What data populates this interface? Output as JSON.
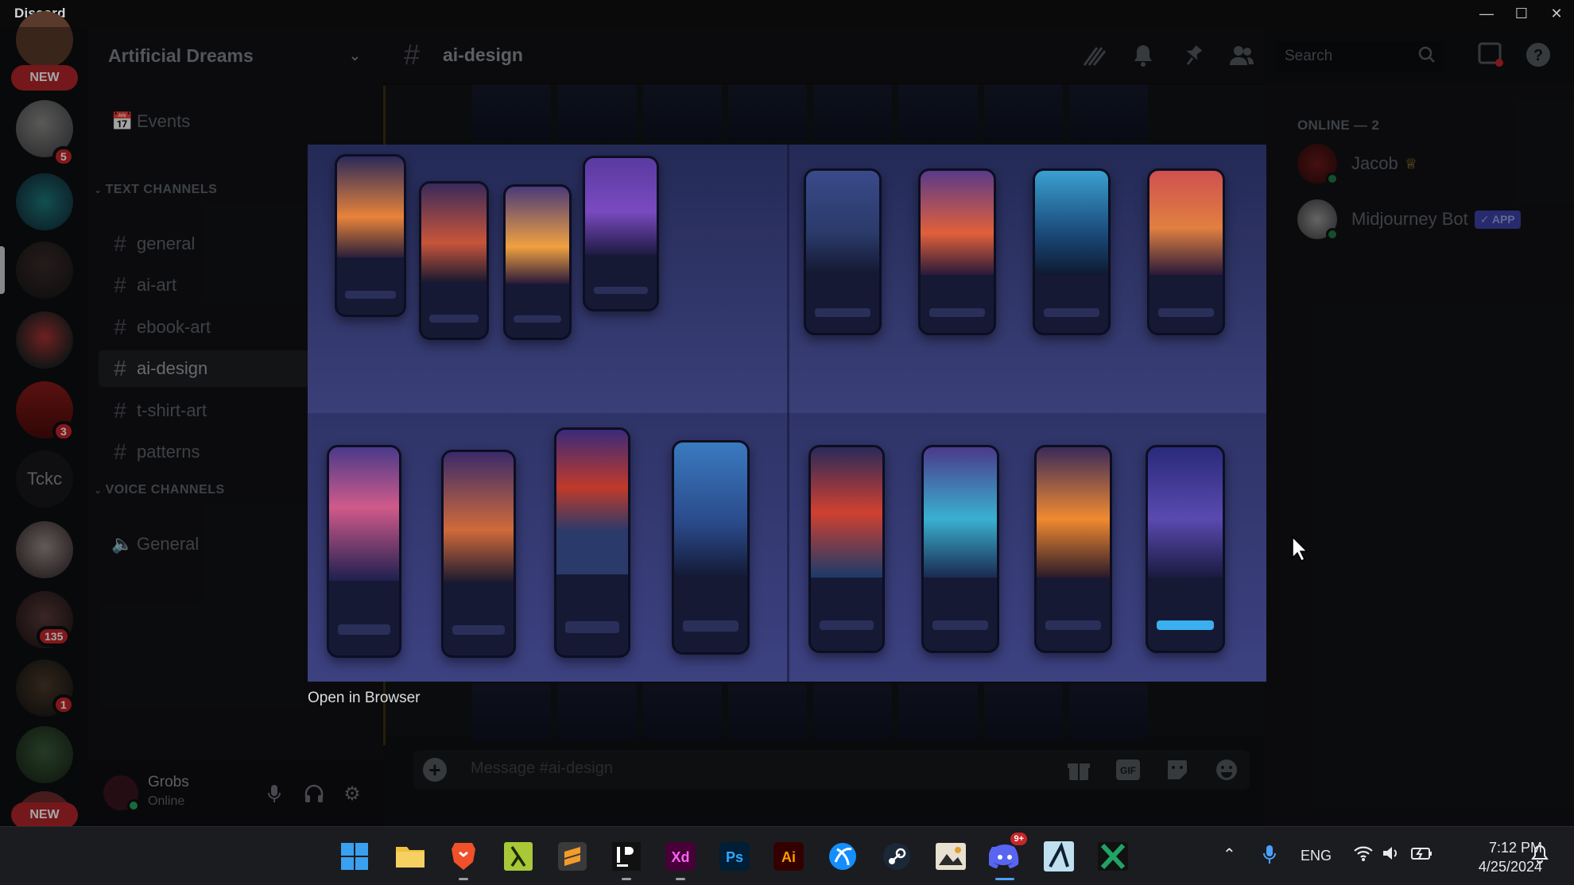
{
  "app": {
    "title": "Discord",
    "window_controls": [
      "minimize",
      "maximize",
      "close"
    ]
  },
  "servers": {
    "new_top": "NEW",
    "new_bottom": "NEW",
    "badges": [
      "5",
      "3",
      "135",
      "1"
    ],
    "tckc": "Tckc"
  },
  "sidebar": {
    "server_name": "Artificial Dreams",
    "events": "Events",
    "text_header": "TEXT CHANNELS",
    "text_channels": [
      "general",
      "ai-art",
      "ebook-art",
      "ai-design",
      "t-shirt-art",
      "patterns"
    ],
    "voice_header": "VOICE CHANNELS",
    "voice_channels": [
      "General"
    ],
    "active": "ai-design"
  },
  "user": {
    "name": "Grobs",
    "status": "Online"
  },
  "header": {
    "channel": "ai-design",
    "search_placeholder": "Search"
  },
  "composer": {
    "placeholder": "Message #ai-design"
  },
  "members": {
    "online_header": "ONLINE — 2",
    "list": [
      {
        "name": "Jacob",
        "crown": true
      },
      {
        "name": "Midjourney Bot",
        "badge": "✓ APP"
      }
    ]
  },
  "preview": {
    "open_link": "Open in Browser"
  },
  "taskbar": {
    "apps": [
      "windows-start",
      "file-explorer",
      "brave",
      "lambda-app",
      "sublime-text",
      "jetbrains",
      "adobe-xd",
      "photoshop",
      "illustrator",
      "battlenet",
      "steam",
      "picture-app",
      "discord",
      "unknown-app",
      "excel"
    ],
    "discord_badge": "9+",
    "lang": "ENG",
    "time": "7:12 PM",
    "date": "4/25/2024"
  },
  "colors": {
    "accent": "#5865f2",
    "online": "#23a55a",
    "badge": "#c7262a"
  }
}
